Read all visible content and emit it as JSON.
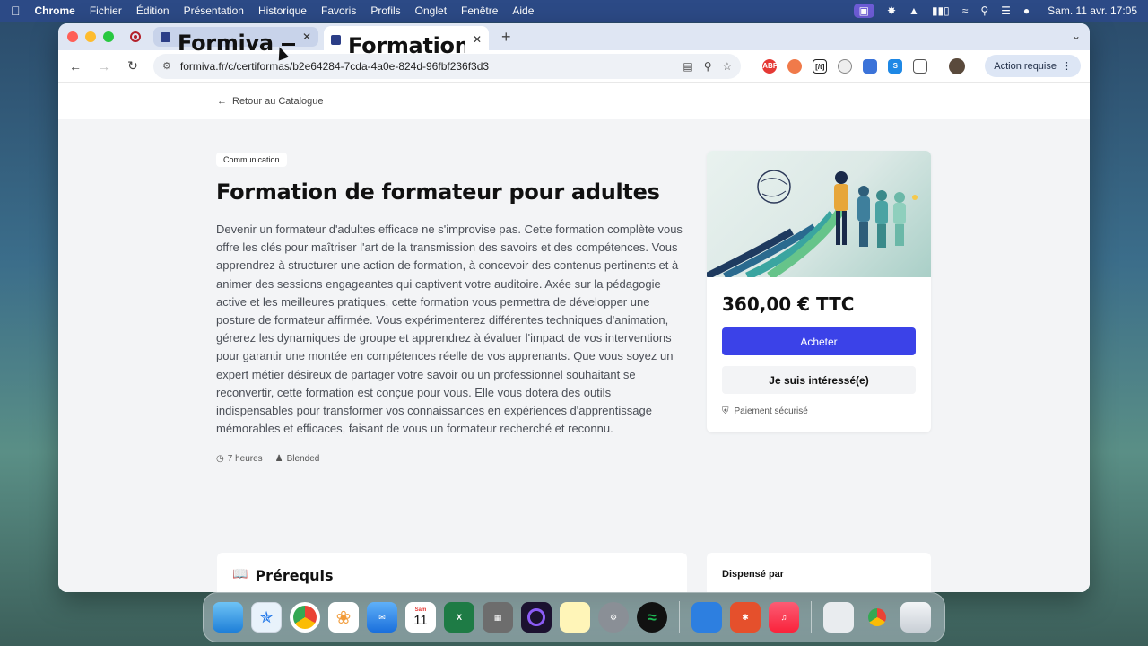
{
  "menubar": {
    "apple": "",
    "app": "Chrome",
    "items": [
      "Fichier",
      "Édition",
      "Présentation",
      "Historique",
      "Favoris",
      "Profils",
      "Onglet",
      "Fenêtre",
      "Aide"
    ],
    "datetime": "Sam. 11 avr.  17:05"
  },
  "browser": {
    "tabs": [
      {
        "title": "Formiva — Plateforme tout-en",
        "active": false
      },
      {
        "title": "Formation de formateur pour",
        "active": true
      }
    ],
    "url": "formiva.fr/c/certiformas/b2e64284-7cda-4a0e-824d-96fbf236f3d3",
    "action_required": "Action requise",
    "extensions": [
      "ABP",
      "",
      "[/t]",
      "",
      "",
      "S",
      ""
    ]
  },
  "page": {
    "back_link": "Retour au Catalogue",
    "category": "Communication",
    "title": "Formation de formateur pour adultes",
    "description": "Devenir un formateur d'adultes efficace ne s'improvise pas. Cette formation complète vous offre les clés pour maîtriser l'art de la transmission des savoirs et des compétences. Vous apprendrez à structurer une action de formation, à concevoir des contenus pertinents et à animer des sessions engageantes qui captivent votre auditoire. Axée sur la pédagogie active et les meilleures pratiques, cette formation vous permettra de développer une posture de formateur affirmée. Vous expérimenterez différentes techniques d'animation, gérerez les dynamiques de groupe et apprendrez à évaluer l'impact de vos interventions pour garantir une montée en compétences réelle de vos apprenants. Que vous soyez un expert métier désireux de partager votre savoir ou un professionnel souhaitant se reconvertir, cette formation est conçue pour vous. Elle vous dotera des outils indispensables pour transformer vos connaissances en expériences d'apprentissage mémorables et efficaces, faisant de vous un formateur recherché et reconnu.",
    "duration": "7 heures",
    "modality": "Blended",
    "price": "360,00 € TTC",
    "buy_label": "Acheter",
    "interest_label": "Je suis intéressé(e)",
    "secure_label": "Paiement sécurisé",
    "prereq_title": "Prérequis",
    "provided_by": "Dispensé par"
  },
  "dock": {
    "calendar_day": "11",
    "calendar_month": "Sam"
  }
}
